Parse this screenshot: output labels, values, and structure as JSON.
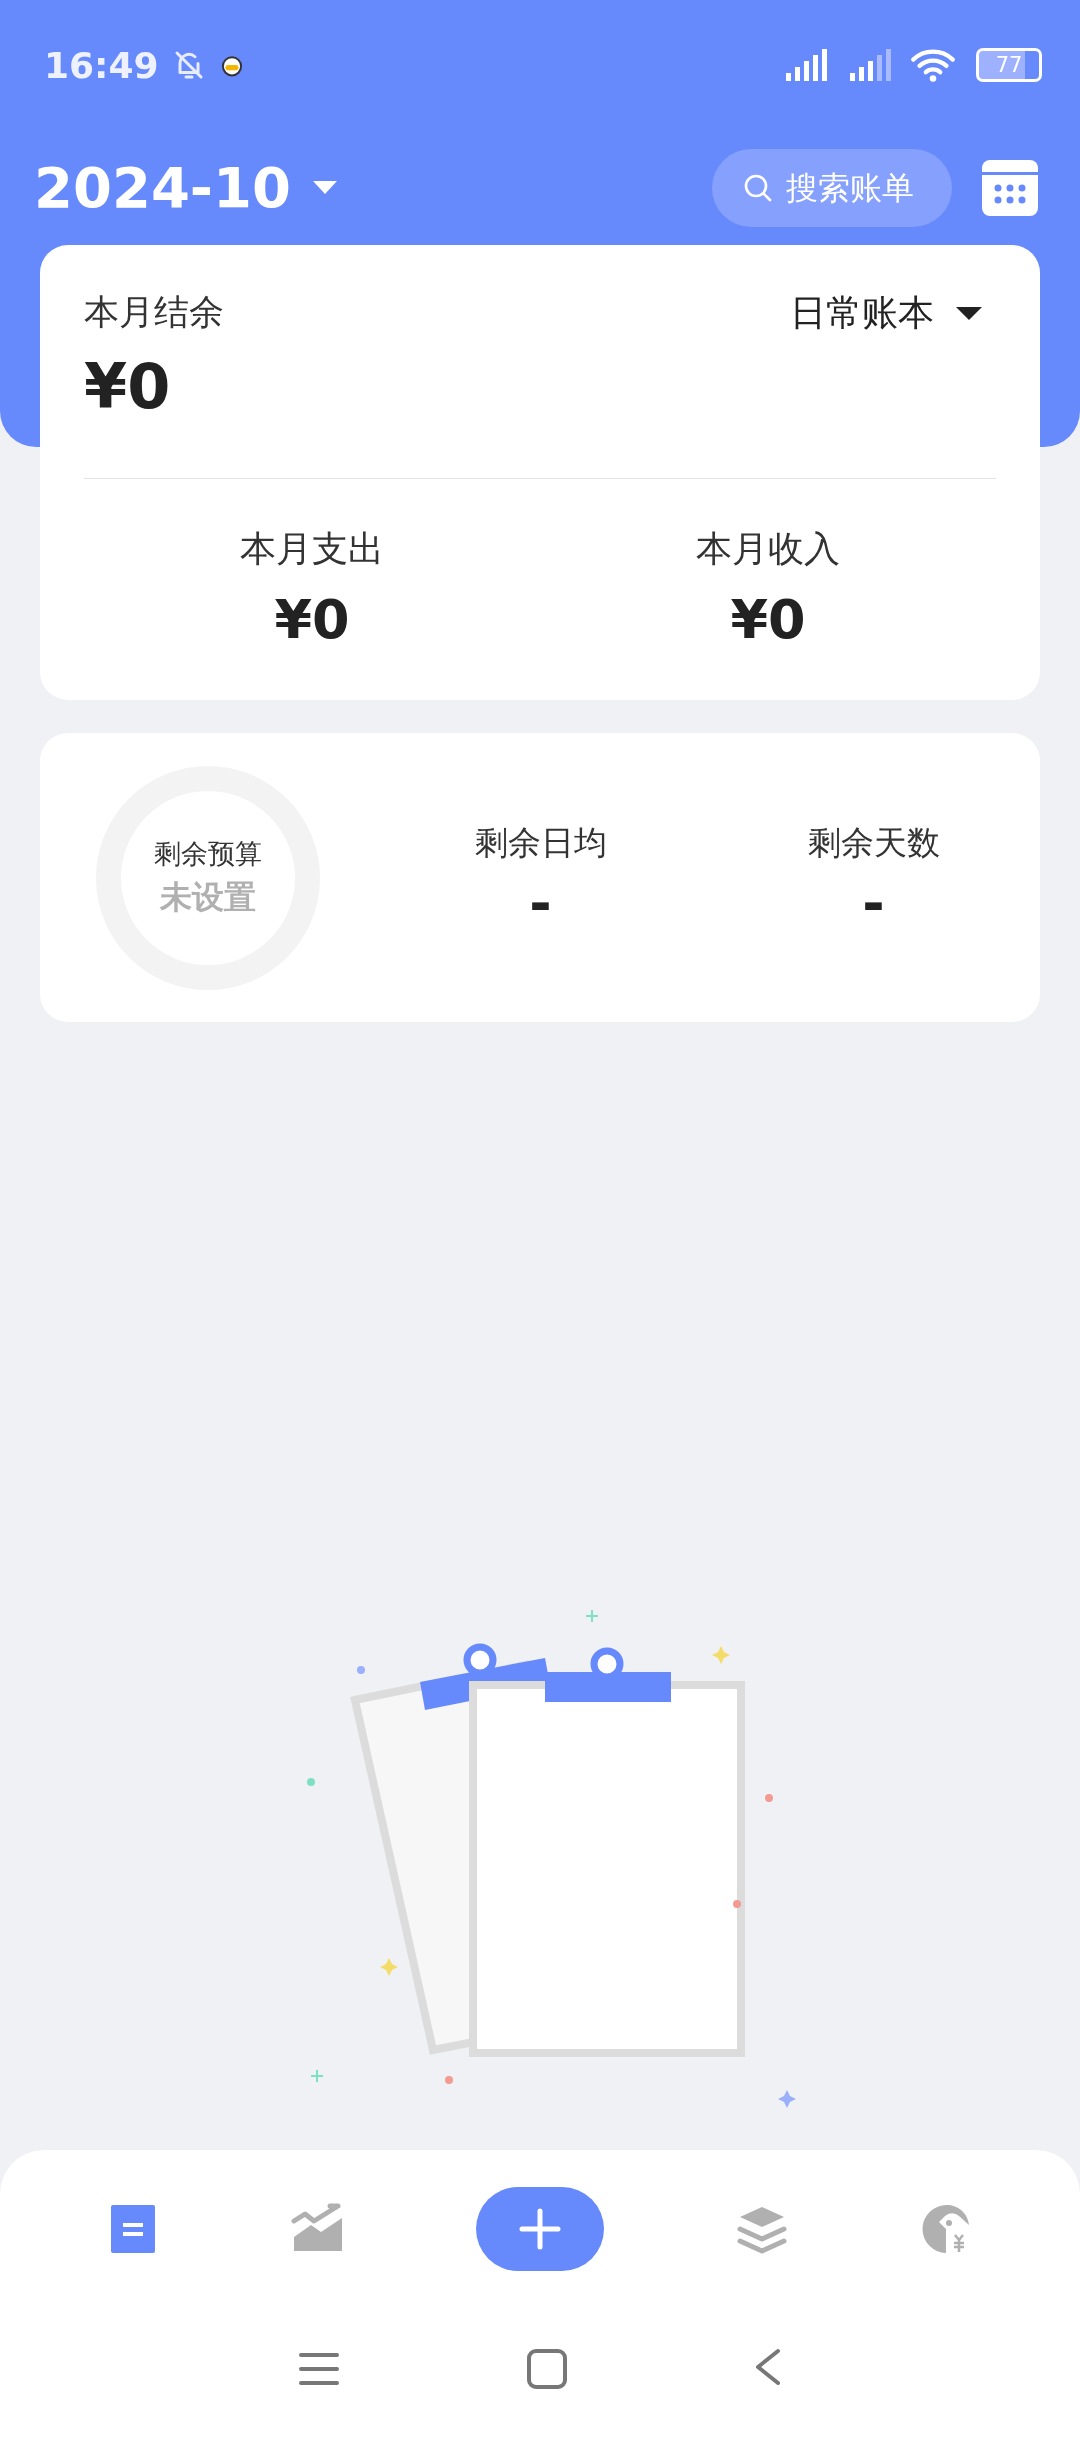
{
  "status_bar": {
    "time": "16:49",
    "battery": "77"
  },
  "header": {
    "month": "2024-10",
    "search": {
      "placeholder": "搜索账单"
    }
  },
  "summary": {
    "label": "本月结余",
    "value": "¥0",
    "book": "日常账本",
    "stats": [
      {
        "label": "本月支出",
        "value": "¥0"
      },
      {
        "label": "本月收入",
        "value": "¥0"
      }
    ]
  },
  "budget": {
    "ring_label": "剩余预算",
    "ring_value": "未设置",
    "stats": [
      {
        "label": "剩余日均",
        "value": "-"
      },
      {
        "label": "剩余天数",
        "value": "-"
      }
    ]
  },
  "bottom_nav": [
    {
      "kind": "tab",
      "selected": true
    },
    {
      "kind": "tab",
      "selected": false
    },
    {
      "kind": "add"
    },
    {
      "kind": "tab",
      "selected": false
    },
    {
      "kind": "tab",
      "selected": false
    }
  ]
}
